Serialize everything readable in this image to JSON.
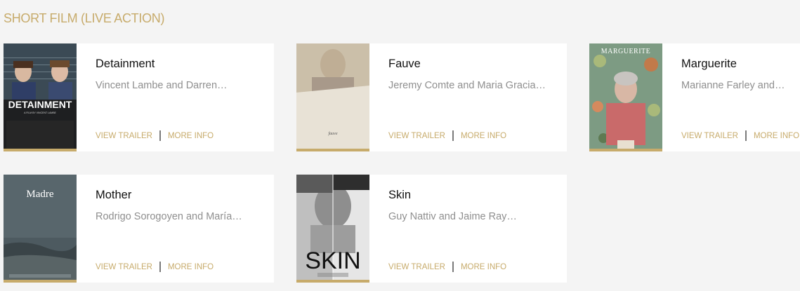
{
  "section": {
    "title": "SHORT FILM (LIVE ACTION)"
  },
  "colors": {
    "accent": "#c7ab6b",
    "background": "#f4f4f4",
    "card": "#ffffff"
  },
  "films": [
    {
      "title": "Detainment",
      "nominees": "Vincent Lambe and Darren…",
      "trailer_label": "VIEW TRAILER",
      "info_label": "MORE INFO",
      "poster": {
        "caption": "DETAINMENT",
        "tagline": "A FILM BY VINCENT LAMBE"
      }
    },
    {
      "title": "Fauve",
      "nominees": "Jeremy Comte and Maria Gracia…",
      "trailer_label": "VIEW TRAILER",
      "info_label": "MORE INFO",
      "poster": {
        "caption": "fauve"
      }
    },
    {
      "title": "Marguerite",
      "nominees": "Marianne Farley and…",
      "trailer_label": "VIEW TRAILER",
      "info_label": "MORE INFO",
      "poster": {
        "caption": "MARGUERITE"
      }
    },
    {
      "title": "Mother",
      "nominees": "Rodrigo Sorogoyen and María…",
      "trailer_label": "VIEW TRAILER",
      "info_label": "MORE INFO",
      "poster": {
        "caption": "Madre"
      }
    },
    {
      "title": "Skin",
      "nominees": "Guy Nattiv and Jaime Ray…",
      "trailer_label": "VIEW TRAILER",
      "info_label": "MORE INFO",
      "poster": {
        "caption": "SKIN"
      }
    }
  ]
}
